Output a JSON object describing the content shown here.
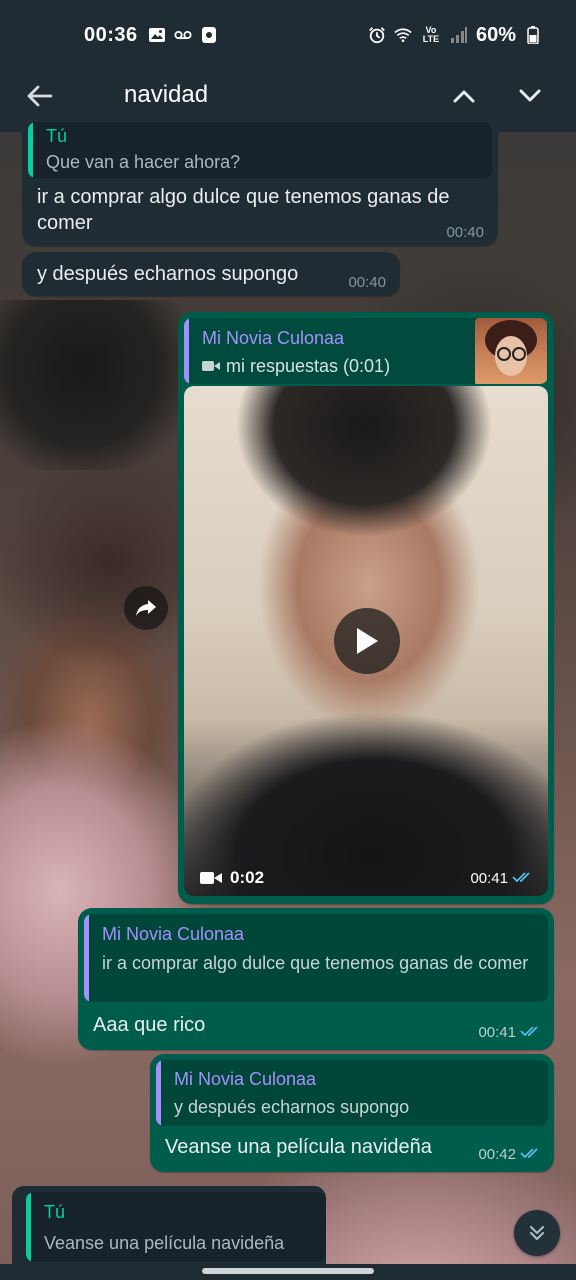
{
  "status_bar": {
    "time": "00:36",
    "battery": "60%",
    "network_label": "Vo LTE"
  },
  "search": {
    "value": "navidad"
  },
  "messages": [
    {
      "direction": "incoming",
      "quote_name": "Tú",
      "quote_text": "Que van a hacer ahora?",
      "text": "ir a comprar algo dulce que tenemos ganas de comer",
      "time": "00:40"
    },
    {
      "direction": "incoming",
      "text": "y después echarnos supongo",
      "time": "00:40"
    },
    {
      "direction": "outgoing",
      "type": "video",
      "quote_name": "Mi Novia Culonaa",
      "quote_text": "mi respuestas (0:01)",
      "video_duration": "0:02",
      "time": "00:41",
      "read": true
    },
    {
      "direction": "outgoing",
      "quote_name": "Mi Novia Culonaa",
      "quote_text": "ir a comprar algo dulce que tenemos ganas de comer",
      "text": "Aaa que rico",
      "time": "00:41",
      "read": true
    },
    {
      "direction": "outgoing",
      "quote_name": "Mi Novia Culonaa",
      "quote_text": "y después echarnos supongo",
      "text": "Veanse una película navideña",
      "time": "00:42",
      "read": true
    }
  ],
  "reply_preview": {
    "name": "Tú",
    "text": "Veanse una película navideña"
  },
  "colors": {
    "header_bg": "#1f2c33",
    "incoming_bubble": "#1f2c34",
    "outgoing_bubble": "#005c4b",
    "quote_name_you": "#06cf9c",
    "quote_name_contact": "#a590ff",
    "read_ticks": "#53bdeb"
  }
}
